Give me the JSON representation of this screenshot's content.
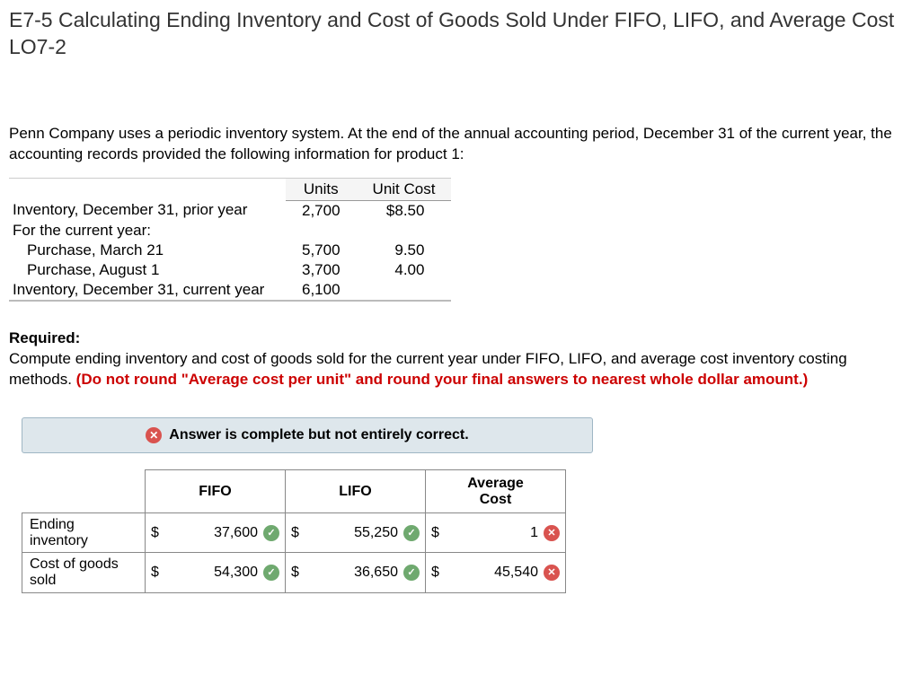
{
  "title": "E7-5 Calculating Ending Inventory and Cost of Goods Sold Under FIFO, LIFO, and Average Cost LO7-2",
  "intro": "Penn Company uses a periodic inventory system. At the end of the annual accounting period, December 31 of the current year, the accounting records provided the following information for product 1:",
  "info_headers": {
    "units": "Units",
    "unit_cost": "Unit Cost"
  },
  "info_rows": [
    {
      "desc": "Inventory, December 31, prior year",
      "units": "2,700",
      "cost": "$8.50",
      "indent": false
    },
    {
      "desc": "For the current year:",
      "units": "",
      "cost": "",
      "indent": false
    },
    {
      "desc": "Purchase, March 21",
      "units": "5,700",
      "cost": "9.50",
      "indent": true
    },
    {
      "desc": "Purchase, August 1",
      "units": "3,700",
      "cost": "4.00",
      "indent": true
    },
    {
      "desc": "Inventory, December 31, current year",
      "units": "6,100",
      "cost": "",
      "indent": false
    }
  ],
  "required_label": "Required:",
  "required_text": "Compute ending inventory and cost of goods sold for the current year under FIFO, LIFO, and average cost inventory costing methods. ",
  "required_note": "(Do not round \"Average cost per unit\" and round your final answers to nearest whole dollar amount.)",
  "feedback": "Answer is complete but not entirely correct.",
  "answer_headers": {
    "fifo": "FIFO",
    "lifo": "LIFO",
    "avg1": "Average",
    "avg2": "Cost"
  },
  "answer_rows": [
    {
      "label1": "Ending",
      "label2": "inventory",
      "fifo": {
        "v": "37,600",
        "ok": true
      },
      "lifo": {
        "v": "55,250",
        "ok": true
      },
      "avg": {
        "v": "1",
        "ok": false
      }
    },
    {
      "label1": "Cost of goods",
      "label2": "sold",
      "fifo": {
        "v": "54,300",
        "ok": true
      },
      "lifo": {
        "v": "36,650",
        "ok": true
      },
      "avg": {
        "v": "45,540",
        "ok": false
      }
    }
  ],
  "dollar": "$",
  "check_glyph": "✓",
  "x_glyph": "✕"
}
